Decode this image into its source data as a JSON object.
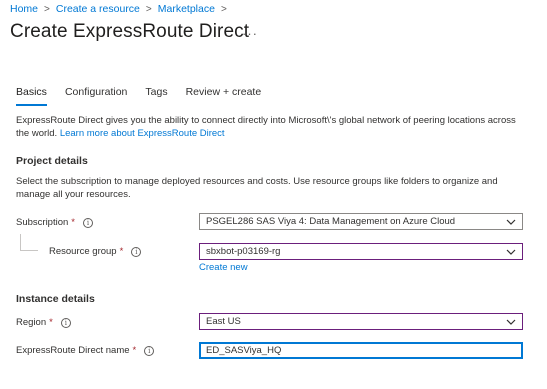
{
  "breadcrumb": {
    "items": [
      "Home",
      "Create a resource",
      "Marketplace"
    ],
    "separator": ">"
  },
  "page": {
    "title": "Create ExpressRoute Direct",
    "more_label": "···"
  },
  "tabs": [
    {
      "label": "Basics",
      "active": true
    },
    {
      "label": "Configuration",
      "active": false
    },
    {
      "label": "Tags",
      "active": false
    },
    {
      "label": "Review + create",
      "active": false
    }
  ],
  "intro": {
    "text": "ExpressRoute Direct gives you the ability to connect directly into Microsoft\\'s global network of peering locations across the world. ",
    "link": "Learn more about ExpressRoute Direct"
  },
  "project_details": {
    "title": "Project details",
    "description": "Select the subscription to manage deployed resources and costs. Use resource groups like folders to organize and manage all your resources.",
    "subscription": {
      "label": "Subscription",
      "required_mark": "*",
      "value": "PSGEL286 SAS Viya 4: Data Management on Azure Cloud"
    },
    "resource_group": {
      "label": "Resource group",
      "required_mark": "*",
      "value": "sbxbot-p03169-rg",
      "create_new": "Create new"
    }
  },
  "instance_details": {
    "title": "Instance details",
    "region": {
      "label": "Region",
      "required_mark": "*",
      "value": "East US"
    },
    "name": {
      "label": "ExpressRoute Direct name",
      "required_mark": "*",
      "value": "ED_SASViya_HQ"
    }
  },
  "icons": {
    "info": "info-icon",
    "chevron": "chevron-down-icon",
    "more": "more-icon"
  },
  "colors": {
    "link": "#0078d4",
    "required": "#a4262c",
    "focus_border": "#0078d4",
    "validated_border": "#6b1f7c"
  }
}
